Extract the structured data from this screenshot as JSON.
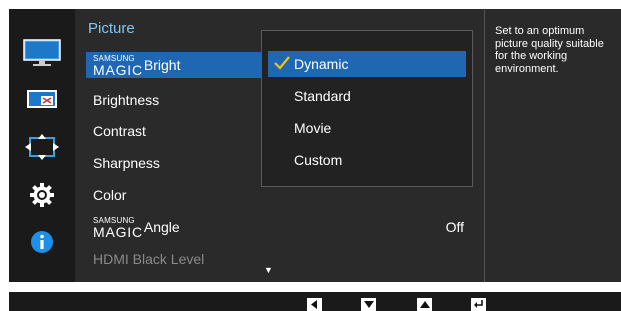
{
  "menu": {
    "title": "Picture",
    "items": [
      {
        "brand_small": "SAMSUNG",
        "brand_large": "MAGIC",
        "label": "Bright"
      },
      {
        "label": "Brightness"
      },
      {
        "label": "Contrast"
      },
      {
        "label": "Sharpness"
      },
      {
        "label": "Color"
      },
      {
        "brand_small": "SAMSUNG",
        "brand_large": "MAGIC",
        "label": "Angle",
        "value": "Off"
      },
      {
        "label": "HDMI Black Level"
      }
    ]
  },
  "dropdown": {
    "options": [
      "Dynamic",
      "Standard",
      "Movie",
      "Custom"
    ],
    "selected": "Dynamic"
  },
  "help": {
    "text": "Set to an optimum picture quality suitable for the working environment."
  },
  "rail": {
    "icons": [
      "monitor-icon",
      "pip-icon",
      "resize-icon",
      "gear-icon",
      "info-icon"
    ]
  },
  "bottom_bar": {
    "keys": [
      "left-key-icon",
      "down-key-icon",
      "up-key-icon",
      "enter-key-icon"
    ]
  },
  "colors": {
    "accent": "#1f66b3",
    "title": "#7ec8f4",
    "check": "#f0c800",
    "panel": "#2a2a2a",
    "dim_text": "#8a8a8a"
  }
}
